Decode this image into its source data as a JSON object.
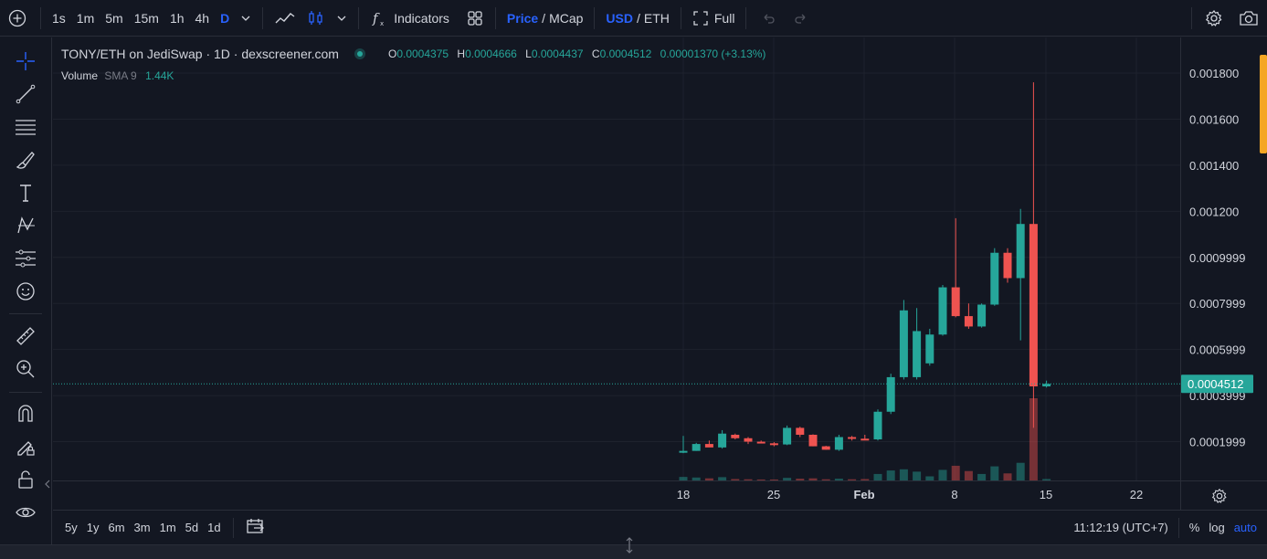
{
  "toolbar": {
    "intervals": [
      "1s",
      "1m",
      "5m",
      "15m",
      "1h",
      "4h",
      "D"
    ],
    "active_interval": "D",
    "indicators_label": "Indicators",
    "price_label": "Price",
    "mcap_label": "MCap",
    "price_sep": "/",
    "usd_label": "USD",
    "eth_label": "ETH",
    "full_label": "Full"
  },
  "legend": {
    "symbol": "TONY/ETH on JediSwap · 1D · dexscreener.com",
    "o_label": "O",
    "o_value": "0.0004375",
    "h_label": "H",
    "h_value": "0.0004666",
    "l_label": "L",
    "l_value": "0.0004437",
    "c_label": "C",
    "c_value": "0.0004512",
    "change": "0.00001370 (+3.13%)"
  },
  "volume_legend": {
    "label": "Volume",
    "ma": "SMA 9",
    "value": "1.44K"
  },
  "price_axis": {
    "labels": [
      "0.001800",
      "0.001600",
      "0.001400",
      "0.001200",
      "0.0009999",
      "0.0007999",
      "0.0005999",
      "0.0003999",
      "0.0001999"
    ],
    "current_price": "0.0004512"
  },
  "time_axis": {
    "labels": [
      "18",
      "25",
      "Feb",
      "8",
      "15",
      "22"
    ]
  },
  "bottom": {
    "ranges": [
      "5y",
      "1y",
      "6m",
      "3m",
      "1m",
      "5d",
      "1d"
    ],
    "clock": "11:12:19 (UTC+7)",
    "percent_label": "%",
    "log_label": "log",
    "auto_label": "auto"
  },
  "colors": {
    "up": "#26a69a",
    "down": "#ef5350",
    "accent": "#2962ff",
    "background": "#131722"
  },
  "chart_data": {
    "type": "candlestick",
    "title": "TONY/ETH on JediSwap · 1D · dexscreener.com",
    "ylim": [
      0,
      0.0018
    ],
    "candles": [
      {
        "o": 0.000155,
        "h": 0.000225,
        "l": 0.00015,
        "c": 0.00016
      },
      {
        "o": 0.00016,
        "h": 0.000195,
        "l": 0.00016,
        "c": 0.00019
      },
      {
        "o": 0.00019,
        "h": 0.000205,
        "l": 0.00018,
        "c": 0.000175
      },
      {
        "o": 0.000175,
        "h": 0.00025,
        "l": 0.00017,
        "c": 0.000235
      },
      {
        "o": 0.00023,
        "h": 0.000235,
        "l": 0.00021,
        "c": 0.000215
      },
      {
        "o": 0.000215,
        "h": 0.00022,
        "l": 0.00019,
        "c": 0.0002
      },
      {
        "o": 0.0002,
        "h": 0.000205,
        "l": 0.000195,
        "c": 0.000193
      },
      {
        "o": 0.000193,
        "h": 0.000198,
        "l": 0.00018,
        "c": 0.000188
      },
      {
        "o": 0.000188,
        "h": 0.00027,
        "l": 0.000185,
        "c": 0.00026
      },
      {
        "o": 0.00026,
        "h": 0.000265,
        "l": 0.00022,
        "c": 0.00023
      },
      {
        "o": 0.00023,
        "h": 0.000232,
        "l": 0.00018,
        "c": 0.00018
      },
      {
        "o": 0.00018,
        "h": 0.000182,
        "l": 0.000165,
        "c": 0.000165
      },
      {
        "o": 0.000165,
        "h": 0.00023,
        "l": 0.00016,
        "c": 0.00022
      },
      {
        "o": 0.00022,
        "h": 0.000225,
        "l": 0.000205,
        "c": 0.000213
      },
      {
        "o": 0.000213,
        "h": 0.00023,
        "l": 0.00021,
        "c": 0.00021
      },
      {
        "o": 0.00021,
        "h": 0.00034,
        "l": 0.000205,
        "c": 0.00033
      },
      {
        "o": 0.00033,
        "h": 0.000495,
        "l": 0.00032,
        "c": 0.00048
      },
      {
        "o": 0.00048,
        "h": 0.000815,
        "l": 0.00047,
        "c": 0.00077
      },
      {
        "o": 0.00048,
        "h": 0.00078,
        "l": 0.00047,
        "c": 0.00068
      },
      {
        "o": 0.00054,
        "h": 0.00069,
        "l": 0.00053,
        "c": 0.000665
      },
      {
        "o": 0.000665,
        "h": 0.00088,
        "l": 0.00066,
        "c": 0.00087
      },
      {
        "o": 0.00087,
        "h": 0.00117,
        "l": 0.00074,
        "c": 0.000745
      },
      {
        "o": 0.000745,
        "h": 0.0008,
        "l": 0.00069,
        "c": 0.0007
      },
      {
        "o": 0.0007,
        "h": 0.0008,
        "l": 0.000695,
        "c": 0.000795
      },
      {
        "o": 0.000795,
        "h": 0.00104,
        "l": 0.00079,
        "c": 0.00102
      },
      {
        "o": 0.00102,
        "h": 0.00104,
        "l": 0.00089,
        "c": 0.00091
      },
      {
        "o": 0.00091,
        "h": 0.00121,
        "l": 0.00064,
        "c": 0.001145
      },
      {
        "o": 0.001145,
        "h": 0.00176,
        "l": 0.00026,
        "c": 0.00044
      },
      {
        "o": 0.00044,
        "h": 0.000465,
        "l": 0.000435,
        "c": 0.000451
      }
    ],
    "volume": [
      {
        "v": 0.3,
        "up": true
      },
      {
        "v": 0.25,
        "up": true
      },
      {
        "v": 0.18,
        "up": false
      },
      {
        "v": 0.28,
        "up": true
      },
      {
        "v": 0.12,
        "up": false
      },
      {
        "v": 0.1,
        "up": false
      },
      {
        "v": 0.08,
        "up": false
      },
      {
        "v": 0.08,
        "up": false
      },
      {
        "v": 0.22,
        "up": true
      },
      {
        "v": 0.15,
        "up": false
      },
      {
        "v": 0.18,
        "up": false
      },
      {
        "v": 0.1,
        "up": false
      },
      {
        "v": 0.15,
        "up": true
      },
      {
        "v": 0.1,
        "up": false
      },
      {
        "v": 0.12,
        "up": false
      },
      {
        "v": 0.55,
        "up": true
      },
      {
        "v": 0.85,
        "up": true
      },
      {
        "v": 0.95,
        "up": true
      },
      {
        "v": 0.75,
        "up": true
      },
      {
        "v": 0.35,
        "up": true
      },
      {
        "v": 0.9,
        "up": true
      },
      {
        "v": 1.25,
        "up": false
      },
      {
        "v": 0.8,
        "up": false
      },
      {
        "v": 0.55,
        "up": true
      },
      {
        "v": 1.2,
        "up": true
      },
      {
        "v": 0.6,
        "up": false
      },
      {
        "v": 1.5,
        "up": true
      },
      {
        "v": 7.0,
        "up": false
      },
      {
        "v": 0.12,
        "up": true
      }
    ]
  }
}
